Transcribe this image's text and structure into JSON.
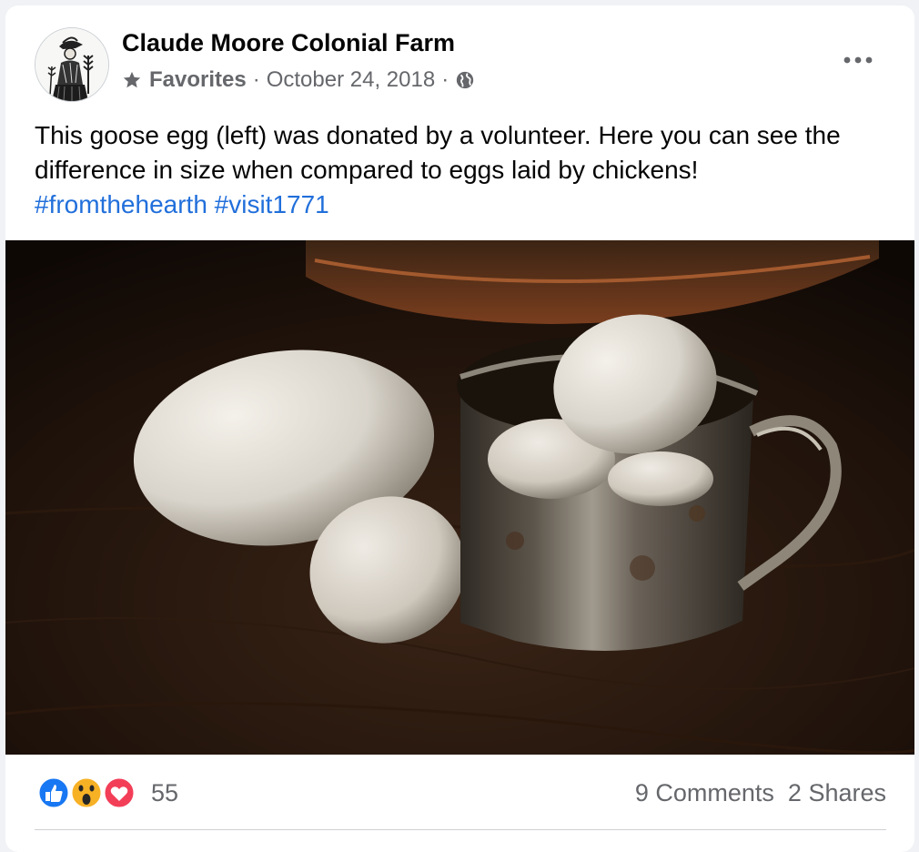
{
  "post": {
    "page_name": "Claude Moore Colonial Farm",
    "favorites_label": "Favorites",
    "separator": "·",
    "date": "October 24, 2018",
    "text": "This goose egg (left) was donated by a volunteer. Here you can see the difference in size when compared to eggs laid by chickens!",
    "hashtags": [
      "#fromthehearth",
      "#visit1771"
    ],
    "icons": {
      "favorite": "star-icon",
      "audience": "globe-icon",
      "menu": "more-options-icon"
    }
  },
  "engagement": {
    "reactions": [
      "like",
      "wow",
      "love"
    ],
    "reaction_count": "55",
    "comments": "9 Comments",
    "shares": "2 Shares"
  },
  "colors": {
    "link": "#216fdb",
    "secondary_text": "#65676b",
    "like": "#1877f2",
    "love": "#f33e58",
    "wow": "#f7b125"
  }
}
